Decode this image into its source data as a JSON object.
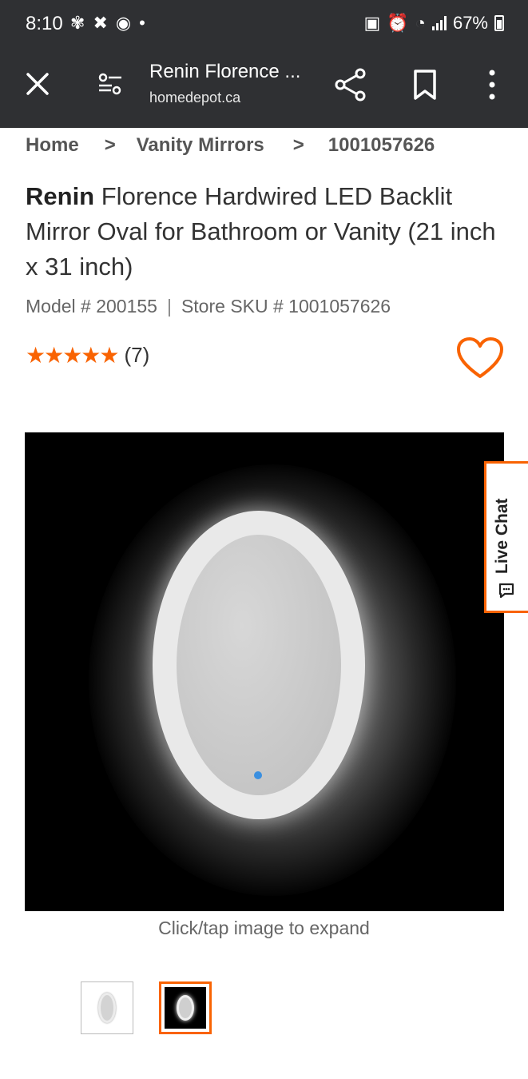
{
  "status_bar": {
    "time": "8:10",
    "battery_percent": "67%"
  },
  "browser": {
    "page_title": "Renin Florence ...",
    "domain": "homedepot.ca"
  },
  "breadcrumb": {
    "items": [
      "Home",
      "Vanity Mirrors",
      "1001057626"
    ],
    "separator": ">"
  },
  "product": {
    "brand": "Renin",
    "title": "Florence Hardwired LED Backlit Mirror Oval for Bathroom or Vanity (21 inch x 31 inch)",
    "model": "Model # 200155",
    "divider": "|",
    "sku": "Store SKU # 1001057626",
    "stars": "★★★★★",
    "rating_value": 5,
    "review_count": "(7)"
  },
  "image_area": {
    "expand_hint": "Click/tap image to expand",
    "live_chat_label": "Live Chat",
    "thumbnails_count": 2,
    "selected_thumbnail": 2
  },
  "colors": {
    "accent": "#f96302",
    "bar_bg": "#2f3033"
  },
  "icons": {
    "close": "close-icon",
    "tune": "tune-icon",
    "share": "share-icon",
    "bookmark": "bookmark-icon",
    "menu": "more-vert-icon",
    "favorite": "heart-icon",
    "chat": "chat-icon"
  }
}
